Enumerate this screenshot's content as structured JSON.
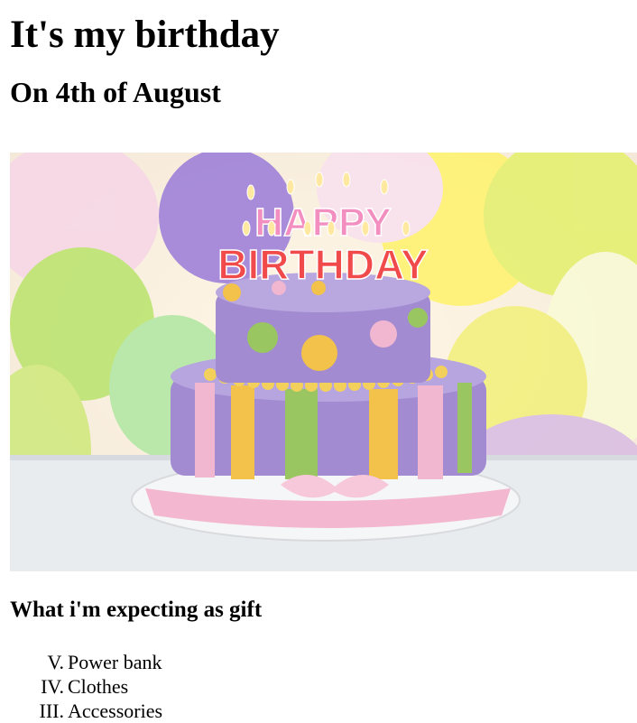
{
  "page": {
    "title": "It's my birthday",
    "subtitle": "On 4th of August",
    "image": {
      "alt_icon": "birthday-cake-image",
      "cake_text_top": "HAPPY",
      "cake_text_bottom": "BIRTHDAY"
    },
    "gifts_heading": "What i'm expecting as gift",
    "gifts": [
      {
        "marker": "V.",
        "label": "Power bank"
      },
      {
        "marker": "IV.",
        "label": "Clothes"
      },
      {
        "marker": "III.",
        "label": "Accessories"
      }
    ]
  },
  "colors": {
    "text": "#000000",
    "background": "#ffffff",
    "cake_purple": "#a28bd0",
    "cake_yellow": "#f2c24a",
    "cake_green": "#9ac662",
    "cake_pink": "#f1b6d0"
  }
}
